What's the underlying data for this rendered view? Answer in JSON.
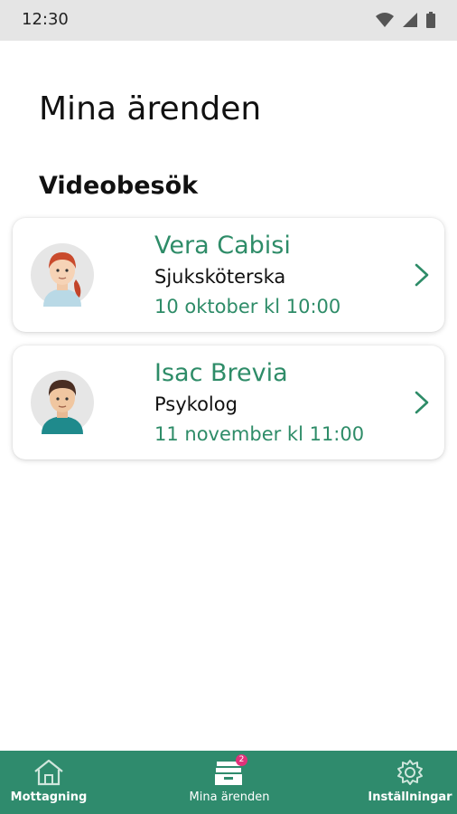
{
  "status_bar": {
    "time": "12:30"
  },
  "page": {
    "title": "Mina ärenden",
    "section_title": "Videobesök"
  },
  "cards": [
    {
      "name": "Vera Cabisi",
      "role": "Sjuksköterska",
      "time": "10 oktober kl 10:00"
    },
    {
      "name": "Isac Brevia",
      "role": "Psykolog",
      "time": "11 november kl 11:00"
    }
  ],
  "bottom_nav": {
    "items": [
      {
        "label": "Mottagning",
        "icon": "home-icon"
      },
      {
        "label": "Mina ärenden",
        "icon": "inbox-icon",
        "badge": "2"
      },
      {
        "label": "Inställningar",
        "icon": "gear-icon"
      }
    ]
  },
  "colors": {
    "accent": "#2e8c68",
    "nav_bg": "#2f8b6d",
    "badge": "#e0327a"
  }
}
